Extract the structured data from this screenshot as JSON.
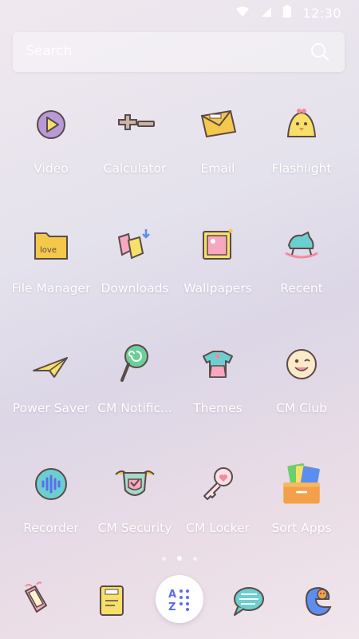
{
  "status_bar": {
    "time": "12:30"
  },
  "search": {
    "placeholder": "Search"
  },
  "apps": [
    {
      "label": "Video",
      "icon": "video-icon"
    },
    {
      "label": "Calculator",
      "icon": "calculator-icon"
    },
    {
      "label": "Email",
      "icon": "email-icon"
    },
    {
      "label": "Flashlight",
      "icon": "flashlight-icon"
    },
    {
      "label": "File Manager",
      "icon": "file-manager-icon"
    },
    {
      "label": "Downloads",
      "icon": "downloads-icon"
    },
    {
      "label": "Wallpapers",
      "icon": "wallpapers-icon"
    },
    {
      "label": "Recent",
      "icon": "recent-icon"
    },
    {
      "label": "Power Saver",
      "icon": "power-saver-icon"
    },
    {
      "label": "CM Notific...",
      "icon": "cm-notification-icon"
    },
    {
      "label": "Themes",
      "icon": "themes-icon"
    },
    {
      "label": "CM Club",
      "icon": "cm-club-icon"
    },
    {
      "label": "Recorder",
      "icon": "recorder-icon"
    },
    {
      "label": "CM Security",
      "icon": "cm-security-icon"
    },
    {
      "label": "CM Locker",
      "icon": "cm-locker-icon"
    },
    {
      "label": "Sort Apps",
      "icon": "sort-apps-icon"
    }
  ],
  "page_indicator": {
    "count": 3,
    "active": 2
  },
  "dock": {
    "items": [
      "phone-icon",
      "contacts-icon",
      "all-apps-icon",
      "messages-icon",
      "browser-icon"
    ],
    "all_apps_text": "A⋮⋮ Z"
  },
  "colors": {
    "accent": "#5b6cf0",
    "outline": "#5a4a4a"
  }
}
